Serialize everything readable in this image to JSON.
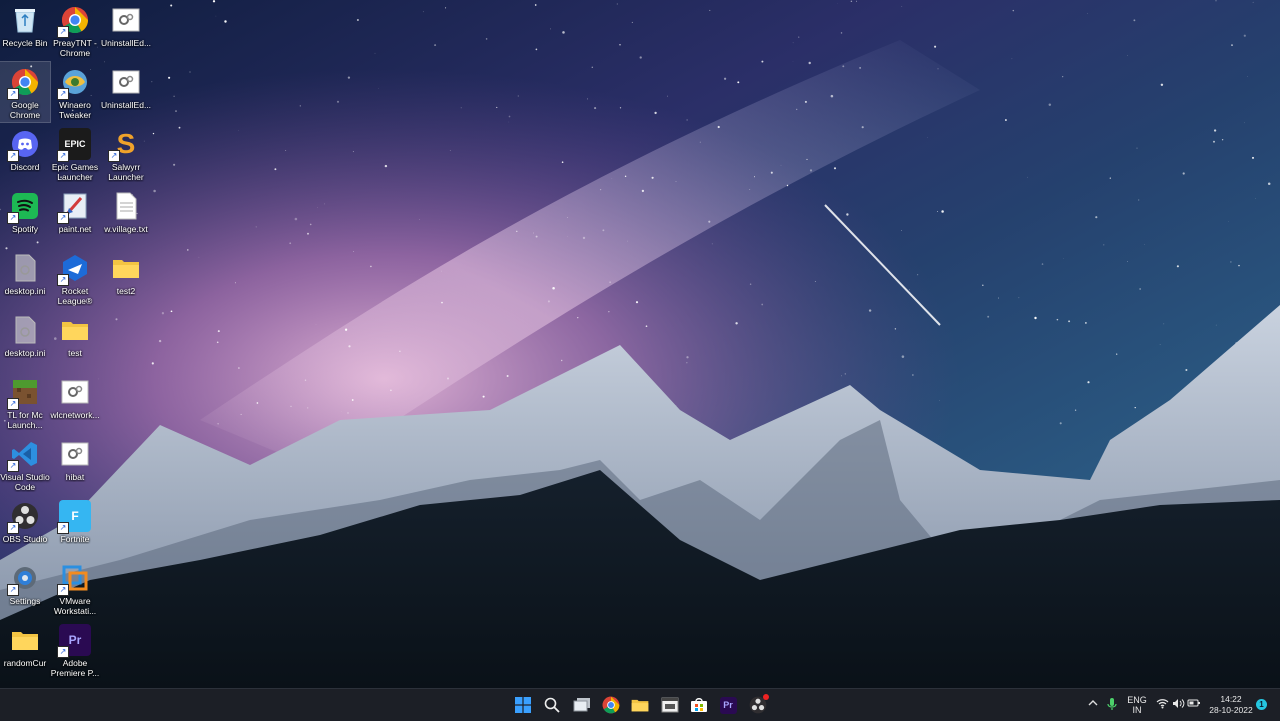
{
  "desktop": {
    "icons": [
      {
        "label": "Recycle Bin",
        "icon": "recycle-bin-icon"
      },
      {
        "label": "PreayTNT - Chrome",
        "icon": "chrome-icon"
      },
      {
        "label": "UninstallEd...",
        "icon": "settings-file-icon"
      },
      {
        "label": "Google Chrome",
        "icon": "chrome-icon"
      },
      {
        "label": "Winaero Tweaker",
        "icon": "winaero-icon"
      },
      {
        "label": "UninstallEd...",
        "icon": "settings-file-icon"
      },
      {
        "label": "Discord",
        "icon": "discord-icon"
      },
      {
        "label": "Epic Games Launcher",
        "icon": "epic-games-icon",
        "glyph": "EPIC"
      },
      {
        "label": "Salwyrr Launcher",
        "icon": "salwyrr-icon",
        "glyph": "S"
      },
      {
        "label": "Spotify",
        "icon": "spotify-icon"
      },
      {
        "label": "paint.net",
        "icon": "paintnet-icon"
      },
      {
        "label": "w.village.txt",
        "icon": "text-file-icon"
      },
      {
        "label": "desktop.ini",
        "icon": "ini-file-icon"
      },
      {
        "label": "Rocket League®",
        "icon": "rocket-league-icon"
      },
      {
        "label": "test2",
        "icon": "folder-icon"
      },
      {
        "label": "desktop.ini",
        "icon": "ini-file-icon"
      },
      {
        "label": "test",
        "icon": "folder-icon"
      },
      {
        "label": "TL for Mc Launch...",
        "icon": "minecraft-icon"
      },
      {
        "label": "wlcnetwork...",
        "icon": "settings-file-icon"
      },
      {
        "label": "Visual Studio Code",
        "icon": "vscode-icon"
      },
      {
        "label": "hibat",
        "icon": "settings-file-icon"
      },
      {
        "label": "OBS Studio",
        "icon": "obs-icon"
      },
      {
        "label": "Fortnite",
        "icon": "fortnite-icon",
        "glyph": "F"
      },
      {
        "label": "Settings",
        "icon": "gear-icon"
      },
      {
        "label": "VMware Workstati...",
        "icon": "vmware-icon"
      },
      {
        "label": "randomCur",
        "icon": "folder-icon"
      },
      {
        "label": "Adobe Premiere P...",
        "icon": "premiere-icon",
        "glyph": "Pr"
      }
    ]
  },
  "taskbar": {
    "apps": [
      {
        "name": "start-button",
        "icon": "windows-logo-icon"
      },
      {
        "name": "search-button",
        "icon": "search-icon"
      },
      {
        "name": "task-view-button",
        "icon": "task-view-icon"
      },
      {
        "name": "taskbar-chrome",
        "icon": "chrome-icon"
      },
      {
        "name": "taskbar-file-explorer",
        "icon": "folder-icon"
      },
      {
        "name": "taskbar-app-window",
        "icon": "window-app-icon"
      },
      {
        "name": "taskbar-store",
        "icon": "store-icon"
      },
      {
        "name": "taskbar-premiere",
        "icon": "premiere-icon",
        "glyph": "Pr"
      },
      {
        "name": "taskbar-obs",
        "icon": "obs-icon"
      }
    ],
    "tray": {
      "lang_top": "ENG",
      "lang_bottom": "IN",
      "time": "14:22",
      "date": "28-10-2022"
    }
  },
  "colors": {
    "taskbar": "#1c1f26",
    "accent": "#3aa0ff"
  }
}
